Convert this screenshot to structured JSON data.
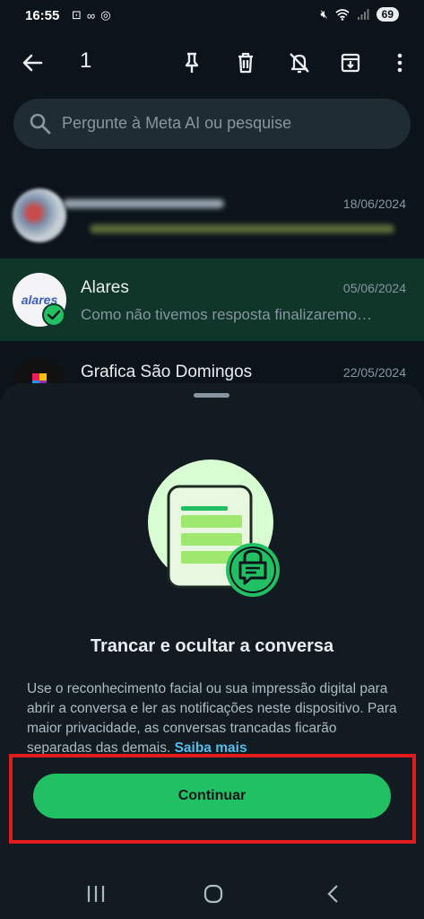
{
  "status": {
    "time": "16:55",
    "left_icons": [
      "screenshot-icon",
      "voicemail-icon",
      "hotspot-icon"
    ],
    "right_icons": [
      "mute-icon",
      "wifi-icon",
      "signal-icon"
    ],
    "battery": "69"
  },
  "action_bar": {
    "selected_count": "1",
    "icons": [
      "back-arrow-icon",
      "pin-icon",
      "trash-icon",
      "mute-notifications-icon",
      "archive-icon",
      "more-vertical-icon"
    ]
  },
  "search": {
    "placeholder": "Pergunte à Meta AI ou pesquise"
  },
  "chats": [
    {
      "name": "",
      "date": "18/06/2024",
      "preview": ""
    },
    {
      "name": "Alares",
      "date": "05/06/2024",
      "preview": "Como não tivemos resposta finalizaremo…",
      "avatar_text": "alares"
    },
    {
      "name": "Grafica São Domingos",
      "date": "22/05/2024",
      "preview": ""
    }
  ],
  "sheet": {
    "title": "Trancar e ocultar a conversa",
    "body": "Use o reconhecimento facial ou sua impressão digital para abrir a conversa e ler as notificações neste dispositivo. Para maior privacidade, as conversas trancadas ficarão separadas das demais.",
    "link": "Saiba mais",
    "continue_label": "Continuar"
  },
  "colors": {
    "accent": "#21c063",
    "selected_row": "#103529",
    "link": "#53bdeb",
    "highlight": "#e01c1c"
  }
}
